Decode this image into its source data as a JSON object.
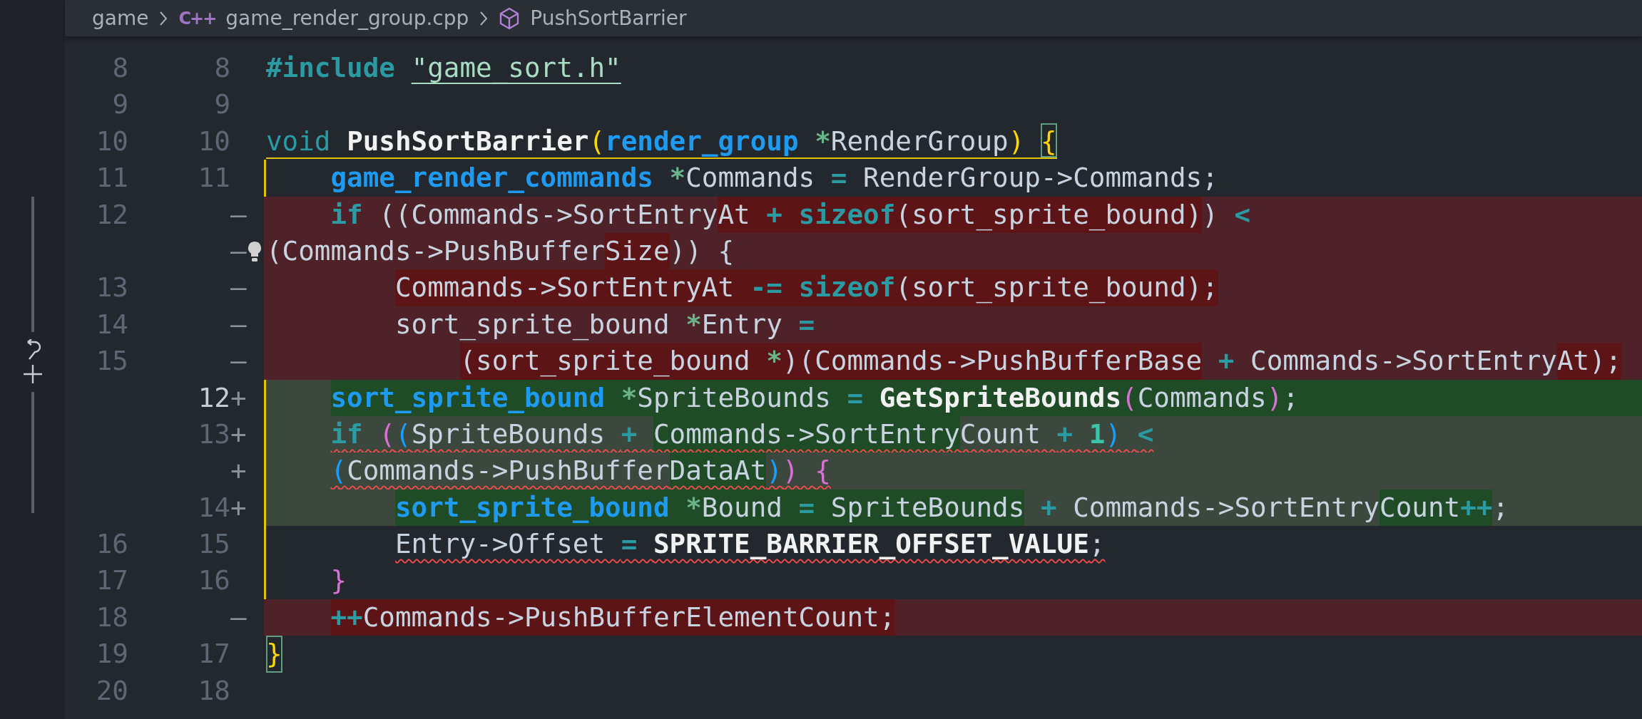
{
  "breadcrumb": [
    {
      "label": "game"
    },
    {
      "label": "game_render_group.cpp",
      "icon_text": "C++"
    },
    {
      "label": "PushSortBarrier"
    }
  ],
  "rows": [
    {
      "old": "8",
      "new": "8",
      "kind": "context",
      "tokens": [
        {
          "t": "#include ",
          "kind": "control"
        },
        {
          "t": "\"game_sort.h\"",
          "kind": "string"
        }
      ]
    },
    {
      "old": "9",
      "new": "9",
      "kind": "context"
    },
    {
      "old": "10",
      "new": "10",
      "kind": "context",
      "guide_start": true,
      "tokens": [
        {
          "t": "void ",
          "kind": "keyword"
        },
        {
          "t": "PushSortBarrier",
          "kind": "function"
        },
        {
          "t": "(",
          "kind": "bracket",
          "color": "#ffd700"
        },
        {
          "t": "render_group ",
          "kind": "type"
        },
        {
          "t": "*",
          "kind": "pointer"
        },
        {
          "t": "RenderGroup",
          "kind": "plain"
        },
        {
          "t": ") ",
          "kind": "bracket",
          "color": "#ffd700"
        },
        {
          "t": "{",
          "kind": "bracket",
          "color": "#ffd700",
          "boxed": true
        }
      ]
    },
    {
      "old": "11",
      "new": "11",
      "kind": "context",
      "guide": true,
      "tokens": [
        {
          "t": "    game_render_commands ",
          "kind": "type"
        },
        {
          "t": "*",
          "kind": "pointer"
        },
        {
          "t": "Commands ",
          "kind": "plain"
        },
        {
          "t": "=",
          "kind": "operator"
        },
        {
          "t": " RenderGroup->Commands;",
          "kind": "plain"
        }
      ]
    },
    {
      "old": "12",
      "mark": "—",
      "kind": "removed",
      "tokens": [
        {
          "t": "    if",
          "kind": "control"
        },
        {
          "t": " ((Commands->SortEntry",
          "kind": "plain"
        },
        {
          "t": "At ",
          "kind": "plain",
          "changed": true
        },
        {
          "t": "+ ",
          "kind": "operator",
          "changed": true
        },
        {
          "t": "sizeof",
          "kind": "control",
          "changed": true
        },
        {
          "t": "(sort_sprite_bound)",
          "kind": "plain",
          "changed": true
        },
        {
          "t": ") ",
          "kind": "plain"
        },
        {
          "t": "<",
          "kind": "operator"
        }
      ]
    },
    {
      "mark": "—",
      "kind": "removed",
      "lightbulb": true,
      "tokens": [
        {
          "t": "(Commands->PushBuffer",
          "kind": "plain"
        },
        {
          "t": "Size",
          "kind": "plain",
          "changed": true
        },
        {
          "t": ")) {",
          "kind": "plain"
        }
      ]
    },
    {
      "old": "13",
      "mark": "—",
      "kind": "removed",
      "tokens": [
        {
          "t": "        Commands->SortEntryAt ",
          "kind": "plain",
          "changed": true
        },
        {
          "t": "-= ",
          "kind": "operator",
          "changed": true
        },
        {
          "t": "sizeof",
          "kind": "control",
          "changed": true
        },
        {
          "t": "(sort_sprite_bound);",
          "kind": "plain",
          "changed": true
        }
      ]
    },
    {
      "old": "14",
      "mark": "—",
      "kind": "removed",
      "tokens": [
        {
          "t": "        sort_sprite_bound ",
          "kind": "plain"
        },
        {
          "t": "*",
          "kind": "pointer"
        },
        {
          "t": "Entry ",
          "kind": "plain"
        },
        {
          "t": "=",
          "kind": "operator"
        }
      ]
    },
    {
      "old": "15",
      "mark": "—",
      "kind": "removed",
      "tokens": [
        {
          "t": "            (sort_sprite_bound ",
          "kind": "plain",
          "changed": true
        },
        {
          "t": "*",
          "kind": "pointer",
          "changed": true
        },
        {
          "t": ")(Commands->PushBufferBase",
          "kind": "plain",
          "changed": true
        },
        {
          "t": " +",
          "kind": "operator"
        },
        {
          "t": " Commands->SortEntry",
          "kind": "plain"
        },
        {
          "t": "At);",
          "kind": "plain",
          "changed": true
        }
      ]
    },
    {
      "new": "12",
      "mark": "+",
      "kind": "added",
      "current": true,
      "fill": true,
      "guide": true,
      "tokens": [
        {
          "t": "    sort_sprite_bound ",
          "kind": "type",
          "changed": true
        },
        {
          "t": "*",
          "kind": "pointer",
          "changed": true
        },
        {
          "t": "SpriteBounds ",
          "kind": "plain",
          "changed": true
        },
        {
          "t": "= ",
          "kind": "operator",
          "changed": true
        },
        {
          "t": "GetSpriteBounds",
          "kind": "function",
          "changed": true
        },
        {
          "t": "(",
          "kind": "bracket",
          "color": "#da70d6",
          "changed": true
        },
        {
          "t": "Commands",
          "kind": "plain",
          "changed": true
        },
        {
          "t": ")",
          "kind": "bracket",
          "color": "#da70d6",
          "changed": true
        },
        {
          "t": ";",
          "kind": "plain",
          "changed": true
        }
      ]
    },
    {
      "new": "13",
      "mark": "+",
      "kind": "added",
      "guide": true,
      "tokens": [
        {
          "t": "    if ",
          "kind": "control",
          "error": true
        },
        {
          "t": "(",
          "kind": "bracket",
          "color": "#da70d6",
          "error": true
        },
        {
          "t": "(",
          "kind": "bracket",
          "color": "#179fff",
          "error": true
        },
        {
          "t": "SpriteBounds ",
          "kind": "plain",
          "error": true
        },
        {
          "t": "+ ",
          "kind": "operator",
          "error": true
        },
        {
          "t": "Commands->SortEntry",
          "kind": "plain",
          "changed": true,
          "error": true
        },
        {
          "t": "Count ",
          "kind": "plain",
          "error": true
        },
        {
          "t": "+ ",
          "kind": "operator",
          "error": true
        },
        {
          "t": "1",
          "kind": "number",
          "error": true
        },
        {
          "t": ") ",
          "kind": "bracket",
          "color": "#179fff",
          "error": true
        },
        {
          "t": "<",
          "kind": "operator",
          "error": true
        }
      ]
    },
    {
      "mark": "+",
      "kind": "added",
      "guide": true,
      "tokens": [
        {
          "t": "    (",
          "kind": "bracket",
          "color": "#179fff",
          "error": true
        },
        {
          "t": "Commands->PushBuffer",
          "kind": "plain",
          "error": true
        },
        {
          "t": "DataAt",
          "kind": "plain",
          "changed": true,
          "error": true
        },
        {
          "t": ")",
          "kind": "bracket",
          "color": "#179fff",
          "error": true
        },
        {
          "t": ") ",
          "kind": "bracket",
          "color": "#da70d6",
          "error": true
        },
        {
          "t": "{",
          "kind": "bracket",
          "color": "#da70d6",
          "error": true
        }
      ]
    },
    {
      "new": "14",
      "mark": "+",
      "kind": "added",
      "guide": true,
      "tokens": [
        {
          "t": "        sort_sprite_bound ",
          "kind": "type",
          "changed": true
        },
        {
          "t": "*",
          "kind": "pointer",
          "changed": true
        },
        {
          "t": "Bound ",
          "kind": "plain",
          "changed": true
        },
        {
          "t": "= ",
          "kind": "operator",
          "changed": true
        },
        {
          "t": "SpriteBounds",
          "kind": "plain",
          "changed": true
        },
        {
          "t": " +",
          "kind": "operator"
        },
        {
          "t": " Commands->SortEntry",
          "kind": "plain"
        },
        {
          "t": "Count",
          "kind": "plain",
          "changed": true
        },
        {
          "t": "++",
          "kind": "operator",
          "changed": true
        },
        {
          "t": ";",
          "kind": "plain"
        }
      ]
    },
    {
      "old": "16",
      "new": "15",
      "kind": "context",
      "guide": true,
      "tokens": [
        {
          "t": "        Entry->Offset ",
          "kind": "plain",
          "error": true
        },
        {
          "t": "= ",
          "kind": "operator",
          "error": true
        },
        {
          "t": "SPRITE_BARRIER_OFFSET_VALUE",
          "kind": "function",
          "error": true
        },
        {
          "t": ";",
          "kind": "plain",
          "error": true
        }
      ]
    },
    {
      "old": "17",
      "new": "16",
      "kind": "context",
      "guide": true,
      "tokens": [
        {
          "t": "    }",
          "kind": "bracket",
          "color": "#da70d6"
        }
      ]
    },
    {
      "old": "18",
      "mark": "—",
      "kind": "removed",
      "tokens": [
        {
          "t": "    ++",
          "kind": "operator",
          "changed": true
        },
        {
          "t": "Commands->PushBufferElementCount;",
          "kind": "plain",
          "changed": true
        }
      ]
    },
    {
      "old": "19",
      "new": "17",
      "kind": "context",
      "tokens": [
        {
          "t": "}",
          "kind": "bracket",
          "color": "#ffd700",
          "boxed": true
        }
      ]
    },
    {
      "old": "20",
      "new": "18",
      "kind": "context"
    }
  ]
}
